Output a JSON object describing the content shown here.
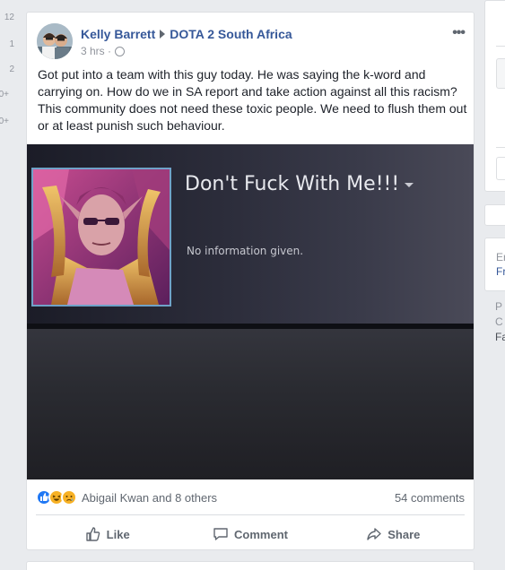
{
  "left_counts": [
    "12",
    "1",
    "2",
    "0+",
    "0+"
  ],
  "post": {
    "author": "Kelly Barrett",
    "group": "DOTA 2 South Africa",
    "time": "3 hrs",
    "text": "Got put into a team with this guy today. He was saying the k-word and carrying on. How do we in SA report and take action against all this racism? This community does not need these toxic people. We need to flush them out or at least punish such behaviour.",
    "image": {
      "profile_name": "Don't Fuck With Me!!!",
      "profile_info": "No information given."
    },
    "reactions": {
      "icons": [
        "like-icon",
        "haha-icon",
        "sad-icon"
      ],
      "summary": "Abigail Kwan and 8 others",
      "comments": "54 comments"
    },
    "actions": {
      "like": "Like",
      "comment": "Comment",
      "share": "Share"
    }
  },
  "right_col": {
    "snippet1": "Er",
    "snippet1_link": "Fr",
    "snippet2a": "P",
    "snippet2b": "C",
    "snippet2c": "Fa"
  },
  "colors": {
    "link": "#365899",
    "secondary": "#606770",
    "like_blue": "#2078f4"
  }
}
